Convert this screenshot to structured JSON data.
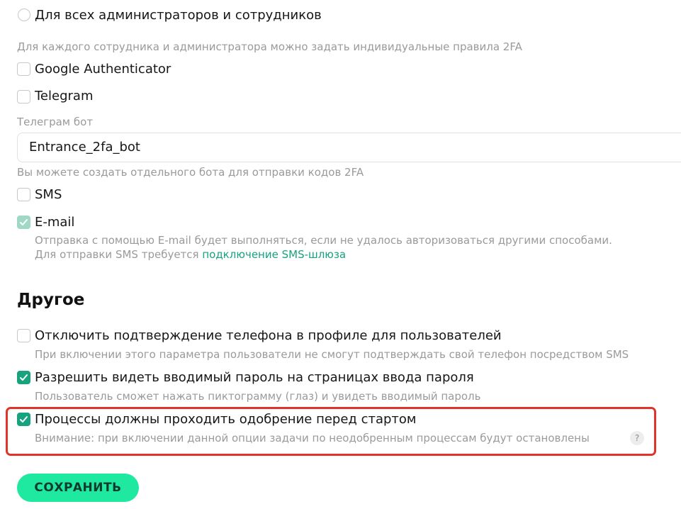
{
  "twofa": {
    "radio_all_label": "Для всех администраторов и сотрудников",
    "radio_all_hint": "Для каждого сотрудника и администратора можно задать индивидуальные правила 2FA",
    "google_label": "Google Authenticator",
    "telegram_label": "Telegram",
    "telegram_bot_label": "Телеграм бот",
    "telegram_bot_value": "Entrance_2fa_bot",
    "telegram_bot_hint": "Вы можете создать отдельного бота для отправки кодов 2FA",
    "sms_label": "SMS",
    "email_label": "E-mail",
    "email_hint": "Отправка с помощью E-mail будет выполняться, если не удалось авторизоваться другими способами.",
    "sms_hint_prefix": "Для отправки SMS требуется ",
    "sms_hint_link": "подключение SMS-шлюза"
  },
  "other": {
    "title": "Другое",
    "disable_phone_label": "Отключить подтверждение телефона в профиле для пользователей",
    "disable_phone_hint": "При включении этого параметра пользователи не смогут подтверждать свой телефон посредством SMS",
    "show_password_label": "Разрешить видеть вводимый пароль на страницах ввода пароля",
    "show_password_hint": "Пользователь сможет нажать пиктограмму (глаз) и увидеть вводимый пароль",
    "approval_label": "Процессы должны проходить одобрение перед стартом",
    "approval_hint": "Внимание: при включении данной опции задачи по неодобренным процессам будут остановлены",
    "help_glyph": "?"
  },
  "actions": {
    "save_label": "СОХРАНИТЬ"
  },
  "colors": {
    "accent": "#17a37d",
    "button": "#1fe9a0",
    "highlight": "#e0342b"
  }
}
